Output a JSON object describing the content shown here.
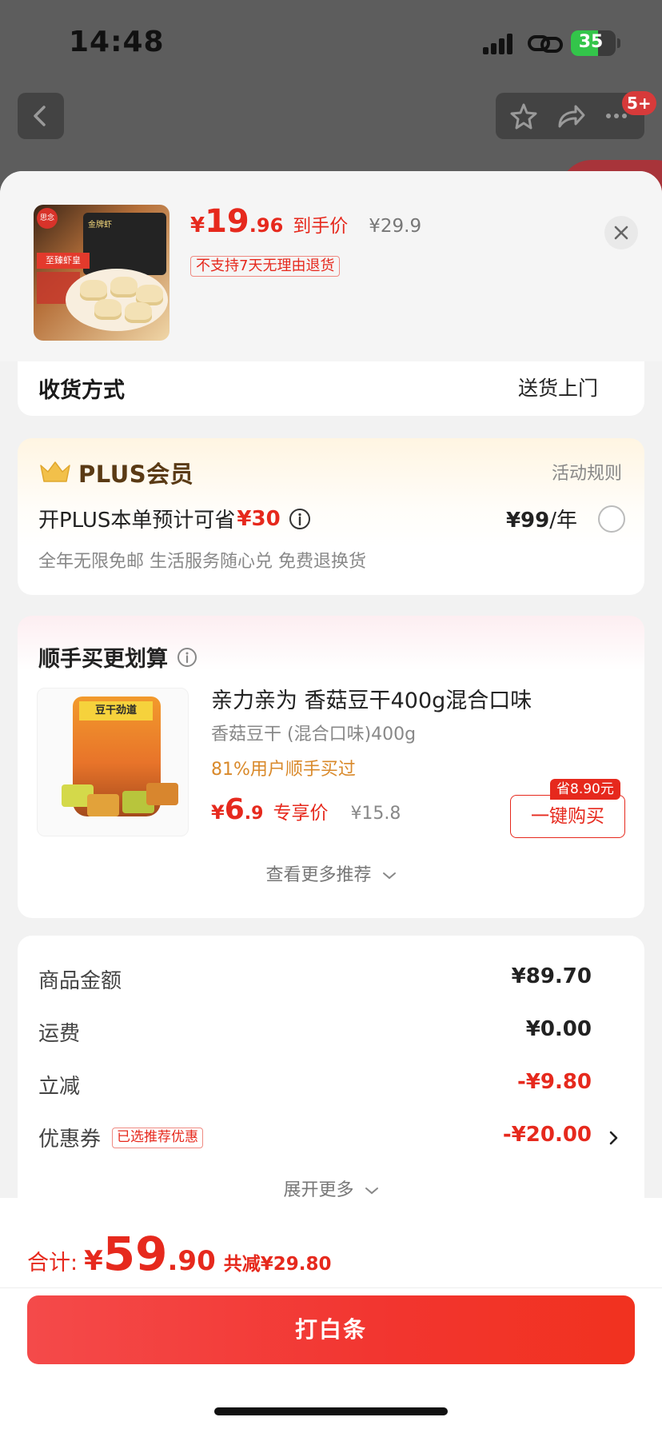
{
  "status_bar": {
    "time": "14:48",
    "battery": "35"
  },
  "nav": {
    "badge": "5+"
  },
  "product": {
    "price_currency": "¥",
    "price_integer": "19",
    "price_decimal": ".96",
    "price_tag": "到手价",
    "original_price": "¥29.9",
    "no_return_label": "不支持7天无理由退货"
  },
  "delivery": {
    "label": "收货方式",
    "value": "送货上门"
  },
  "plus": {
    "title": "PLUS会员",
    "rules": "活动规则",
    "line_prefix": "开PLUS本单预计可省",
    "save_amount": "¥30",
    "price": "¥99",
    "price_unit": "/年",
    "description": "全年无限免邮 生活服务随心兑 免费退换货"
  },
  "recommend": {
    "title": "顺手买更划算",
    "product_name": "亲力亲为 香菇豆干400g混合口味",
    "spec": "香菇豆干 (混合口味)400g",
    "bought_rate": "81%用户顺手买过",
    "price_currency": "¥",
    "price_integer": "6",
    "price_decimal": ".9",
    "price_tag": "专享价",
    "original_price": "¥15.8",
    "save_badge": "省8.90元",
    "buy_button": "一键购买",
    "see_more": "查看更多推荐"
  },
  "summary": {
    "rows": [
      {
        "label": "商品金额",
        "value": "¥89.70"
      },
      {
        "label": "运费",
        "value": "¥0.00"
      },
      {
        "label": "立减",
        "value": "-¥9.80"
      },
      {
        "label": "优惠券",
        "value": "-¥20.00",
        "tag": "已选推荐优惠"
      }
    ],
    "expand_more": "展开更多"
  },
  "bottom": {
    "total_label": "合计:",
    "total_currency": "¥",
    "total_integer": "59",
    "total_decimal": ".90",
    "total_saving": "共减¥29.80",
    "pay_button": "打白条"
  },
  "colors": {
    "accent_red": "#e6291d",
    "plus_gold": "#5a3a14",
    "bought_orange": "#d9892a"
  }
}
